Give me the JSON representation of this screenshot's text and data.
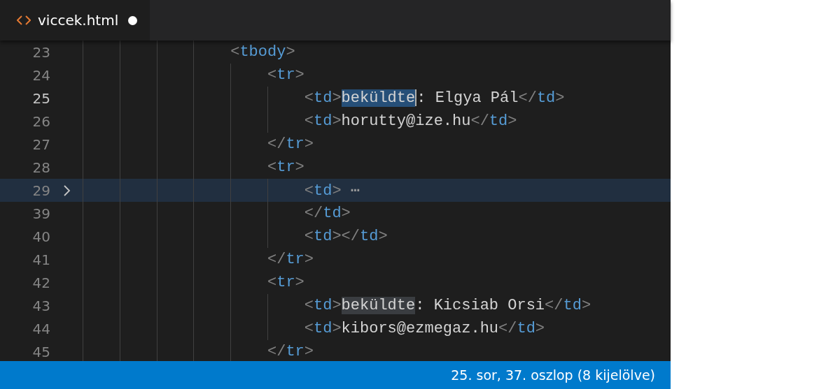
{
  "tabs": [
    {
      "label": "viccek.html",
      "selected": true,
      "dirty": true
    }
  ],
  "lines": [
    {
      "number": "23",
      "current": false,
      "folded": false,
      "segments": [
        {
          "kind": "bracket",
          "text": "<"
        },
        {
          "kind": "tag",
          "text": "tbody"
        },
        {
          "kind": "bracket",
          "text": ">"
        }
      ],
      "children": [
        {
          "number": "24",
          "current": false,
          "folded": false,
          "segments": [
            {
              "kind": "bracket",
              "text": "<"
            },
            {
              "kind": "tag",
              "text": "tr"
            },
            {
              "kind": "bracket",
              "text": ">"
            }
          ],
          "children": [
            {
              "number": "25",
              "current": true,
              "folded": false,
              "segments": [
                {
                  "kind": "bracket",
                  "text": "<"
                },
                {
                  "kind": "tag",
                  "text": "td"
                },
                {
                  "kind": "bracket",
                  "text": ">"
                },
                {
                  "kind": "selection",
                  "text": "beküldte"
                },
                {
                  "kind": "text",
                  "text": ": Elgya Pál"
                },
                {
                  "kind": "bracket",
                  "text": "</"
                },
                {
                  "kind": "tag",
                  "text": "td"
                },
                {
                  "kind": "bracket",
                  "text": ">"
                }
              ]
            },
            {
              "number": "26",
              "current": false,
              "folded": false,
              "segments": [
                {
                  "kind": "bracket",
                  "text": "<"
                },
                {
                  "kind": "tag",
                  "text": "td"
                },
                {
                  "kind": "bracket",
                  "text": ">"
                },
                {
                  "kind": "text",
                  "text": "horutty@ize.hu"
                },
                {
                  "kind": "bracket",
                  "text": "</"
                },
                {
                  "kind": "tag",
                  "text": "td"
                },
                {
                  "kind": "bracket",
                  "text": ">"
                }
              ]
            }
          ]
        },
        {
          "number": "27",
          "current": false,
          "folded": false,
          "segments": [
            {
              "kind": "bracket",
              "text": "</"
            },
            {
              "kind": "tag",
              "text": "tr"
            },
            {
              "kind": "bracket",
              "text": ">"
            }
          ]
        },
        {
          "number": "28",
          "current": false,
          "folded": false,
          "segments": [
            {
              "kind": "bracket",
              "text": "<"
            },
            {
              "kind": "tag",
              "text": "tr"
            },
            {
              "kind": "bracket",
              "text": ">"
            }
          ],
          "children": [
            {
              "number": "29",
              "current": false,
              "folded": true,
              "segments": [
                {
                  "kind": "bracket",
                  "text": "<"
                },
                {
                  "kind": "tag",
                  "text": "td"
                },
                {
                  "kind": "bracket",
                  "text": ">"
                },
                {
                  "kind": "ellipsis",
                  "text": "⋯"
                }
              ]
            },
            {
              "number": "39",
              "current": false,
              "folded": false,
              "segments": [
                {
                  "kind": "bracket",
                  "text": "</"
                },
                {
                  "kind": "tag",
                  "text": "td"
                },
                {
                  "kind": "bracket",
                  "text": ">"
                }
              ]
            },
            {
              "number": "40",
              "current": false,
              "folded": false,
              "segments": [
                {
                  "kind": "bracket",
                  "text": "<"
                },
                {
                  "kind": "tag",
                  "text": "td"
                },
                {
                  "kind": "bracket",
                  "text": "></"
                },
                {
                  "kind": "tag",
                  "text": "td"
                },
                {
                  "kind": "bracket",
                  "text": ">"
                }
              ]
            }
          ]
        },
        {
          "number": "41",
          "current": false,
          "folded": false,
          "segments": [
            {
              "kind": "bracket",
              "text": "</"
            },
            {
              "kind": "tag",
              "text": "tr"
            },
            {
              "kind": "bracket",
              "text": ">"
            }
          ]
        },
        {
          "number": "42",
          "current": false,
          "folded": false,
          "segments": [
            {
              "kind": "bracket",
              "text": "<"
            },
            {
              "kind": "tag",
              "text": "tr"
            },
            {
              "kind": "bracket",
              "text": ">"
            }
          ],
          "children": [
            {
              "number": "43",
              "current": false,
              "folded": false,
              "segments": [
                {
                  "kind": "bracket",
                  "text": "<"
                },
                {
                  "kind": "tag",
                  "text": "td"
                },
                {
                  "kind": "bracket",
                  "text": ">"
                },
                {
                  "kind": "occurrence",
                  "text": "beküldte"
                },
                {
                  "kind": "text",
                  "text": ": Kicsiab Orsi"
                },
                {
                  "kind": "bracket",
                  "text": "</"
                },
                {
                  "kind": "tag",
                  "text": "td"
                },
                {
                  "kind": "bracket",
                  "text": ">"
                }
              ]
            },
            {
              "number": "44",
              "current": false,
              "folded": false,
              "segments": [
                {
                  "kind": "bracket",
                  "text": "<"
                },
                {
                  "kind": "tag",
                  "text": "td"
                },
                {
                  "kind": "bracket",
                  "text": ">"
                },
                {
                  "kind": "text",
                  "text": "kibors@ezmegaz.hu"
                },
                {
                  "kind": "bracket",
                  "text": "</"
                },
                {
                  "kind": "tag",
                  "text": "td"
                },
                {
                  "kind": "bracket",
                  "text": ">"
                }
              ]
            }
          ]
        },
        {
          "number": "45",
          "current": false,
          "folded": false,
          "segments": [
            {
              "kind": "bracket",
              "text": "</"
            },
            {
              "kind": "tag",
              "text": "tr"
            },
            {
              "kind": "bracket",
              "text": ">"
            }
          ]
        }
      ]
    }
  ],
  "status_bar": {
    "position": "25. sor, 37. oszlop (8 kijelölve)"
  }
}
